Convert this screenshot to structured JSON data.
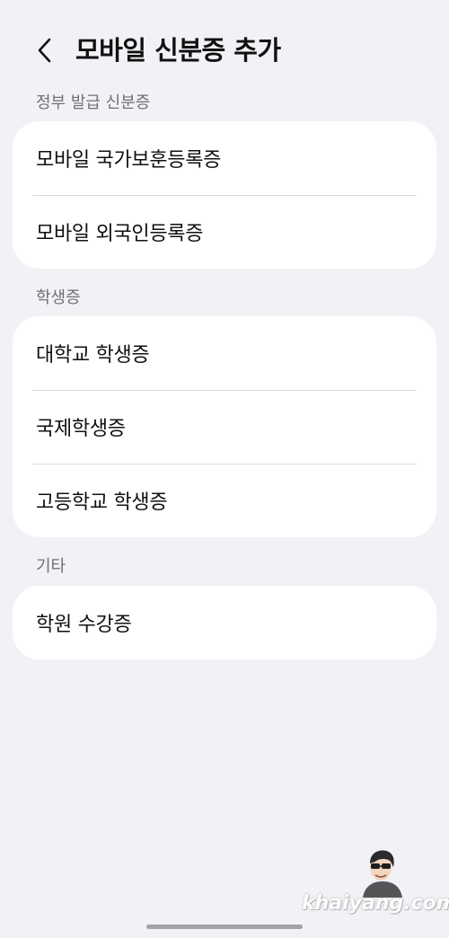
{
  "header": {
    "back_icon": "chevron-left-icon",
    "title": "모바일 신분증 추가"
  },
  "sections": [
    {
      "label": "정부 발급 신분증",
      "items": [
        {
          "label": "모바일 국가보훈등록증"
        },
        {
          "label": "모바일 외국인등록증"
        }
      ]
    },
    {
      "label": "학생증",
      "items": [
        {
          "label": "대학교 학생증"
        },
        {
          "label": "국제학생증"
        },
        {
          "label": "고등학교 학생증"
        }
      ]
    },
    {
      "label": "기타",
      "items": [
        {
          "label": "학원 수강증"
        }
      ]
    }
  ],
  "watermark": {
    "text": "khaiyang.com"
  },
  "colors": {
    "background": "#f2f1f6",
    "card": "#ffffff",
    "section_label": "#707075",
    "divider": "#dcdcdf"
  }
}
